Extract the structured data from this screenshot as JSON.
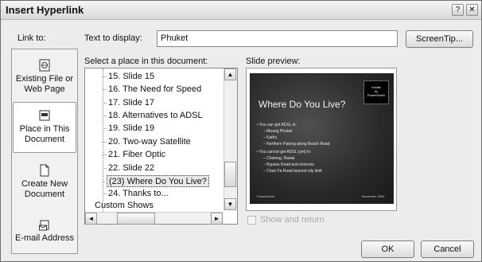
{
  "titlebar": {
    "title": "Insert Hyperlink",
    "help_label": "?",
    "close_label": "✕"
  },
  "link_to": {
    "label": "Link to:",
    "items": [
      {
        "icon": "web-page-icon",
        "line1": "Existing File or",
        "line2": "Web Page"
      },
      {
        "icon": "slide-icon",
        "line1": "Place in This",
        "line2": "Document",
        "selected": true
      },
      {
        "icon": "new-document-icon",
        "line1": "Create New",
        "line2": "Document"
      },
      {
        "icon": "email-icon",
        "line1": "E-mail Address",
        "line2": ""
      }
    ]
  },
  "text_to_display": {
    "label": "Text to display:",
    "value": "Phuket"
  },
  "screentip": {
    "label": "ScreenTip..."
  },
  "select_place": {
    "label": "Select a place in this document:",
    "items": [
      "15. Slide 15",
      "16. The Need for Speed",
      "17. Slide 17",
      "18. Alternatives to ADSL",
      "19. Slide 19",
      "20. Two-way Satellite",
      "21. Fiber Optic",
      "22. Slide 22",
      "(23) Where Do You Live?",
      "24. Thanks to..."
    ],
    "selected_index": 8,
    "custom_shows": "Custom Shows",
    "scroll_left": "◄",
    "scroll_right": "►",
    "scroll_up": "▲",
    "scroll_down": "▼"
  },
  "preview": {
    "label": "Slide preview:",
    "slide_title": "Where Do You Live?",
    "badge": [
      "Kodak",
      "by",
      "PowerSurfer"
    ],
    "lines": [
      "• You can get ADSL in:",
      "– Muang Phuket",
      "– Kathu",
      "– Northern Patong along Beach Road",
      "• You cannot get ADSL (yet) in:",
      "– Chalong, Rawai",
      "– Bypass Road and environs",
      "– Chao Fa Road beyond city limit"
    ],
    "footer_left": "PowerSurfer",
    "footer_right": "November 2004"
  },
  "show_and_return": {
    "label": "Show and return",
    "checked": false
  },
  "buttons": {
    "ok": "OK",
    "cancel": "Cancel"
  }
}
